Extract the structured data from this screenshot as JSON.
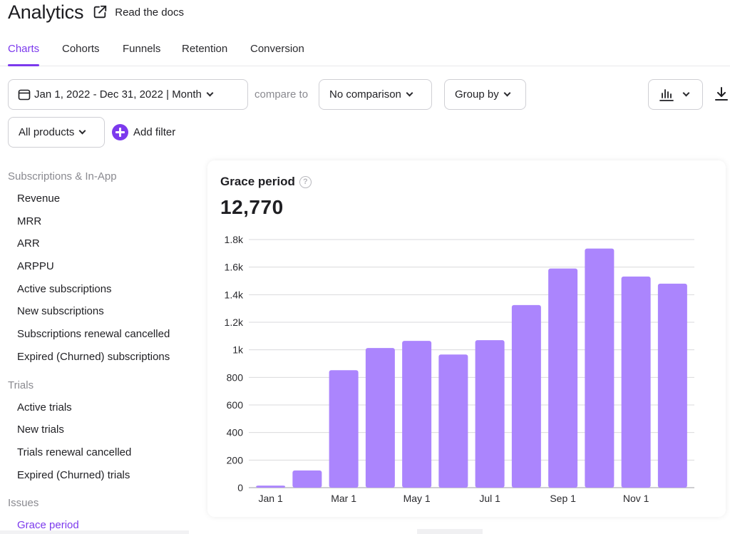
{
  "header": {
    "title": "Analytics",
    "docs_link": "Read the docs",
    "docs_icon": "external-link-icon"
  },
  "tabs": [
    {
      "label": "Charts",
      "active": true
    },
    {
      "label": "Cohorts",
      "active": false
    },
    {
      "label": "Funnels",
      "active": false
    },
    {
      "label": "Retention",
      "active": false
    },
    {
      "label": "Conversion",
      "active": false
    }
  ],
  "toolbar": {
    "date_range": "Jan 1, 2022 - Dec 31, 2022 | Month",
    "date_icon": "calendar-icon",
    "compare_label": "compare to",
    "comparison": "No comparison",
    "group_by": "Group by",
    "chart_type_icon": "bar-chart-icon",
    "download_icon": "download-icon",
    "products": "All products",
    "add_filter": "Add filter"
  },
  "sidebar": {
    "groups": [
      {
        "label": "Subscriptions & In-App",
        "items": [
          {
            "label": "Revenue"
          },
          {
            "label": "MRR"
          },
          {
            "label": "ARR"
          },
          {
            "label": "ARPPU"
          },
          {
            "label": "Active subscriptions"
          },
          {
            "label": "New subscriptions"
          },
          {
            "label": "Subscriptions renewal cancelled"
          },
          {
            "label": "Expired (Churned) subscriptions"
          }
        ]
      },
      {
        "label": "Trials",
        "items": [
          {
            "label": "Active trials"
          },
          {
            "label": "New trials"
          },
          {
            "label": "Trials renewal cancelled"
          },
          {
            "label": "Expired (Churned) trials"
          }
        ]
      },
      {
        "label": "Issues",
        "items": [
          {
            "label": "Grace period",
            "active": true
          }
        ]
      }
    ]
  },
  "card": {
    "title": "Grace period",
    "help_icon": "?",
    "total": "12,770"
  },
  "colors": {
    "accent": "#7c3aed",
    "bar": "#ab85fd",
    "grid": "#d9d9dc"
  },
  "chart_data": {
    "type": "bar",
    "title": "Grace period",
    "categories": [
      "Jan",
      "Feb",
      "Mar",
      "Apr",
      "May",
      "Jun",
      "Jul",
      "Aug",
      "Sep",
      "Oct",
      "Nov",
      "Dec"
    ],
    "values": [
      15,
      125,
      852,
      1013,
      1065,
      966,
      1070,
      1325,
      1590,
      1735,
      1532,
      1480
    ],
    "x_tick_labels": [
      "Jan 1",
      "",
      "Mar 1",
      "",
      "May 1",
      "",
      "Jul 1",
      "",
      "Sep 1",
      "",
      "Nov 1",
      ""
    ],
    "y_ticks": [
      0,
      200,
      400,
      600,
      800,
      1000,
      1200,
      1400,
      1600,
      1800
    ],
    "y_tick_labels": [
      "0",
      "200",
      "400",
      "600",
      "800",
      "1k",
      "1.2k",
      "1.4k",
      "1.6k",
      "1.8k"
    ],
    "ylim": [
      0,
      1800
    ],
    "xlabel": "",
    "ylabel": "",
    "grid": true,
    "legend": "none"
  }
}
